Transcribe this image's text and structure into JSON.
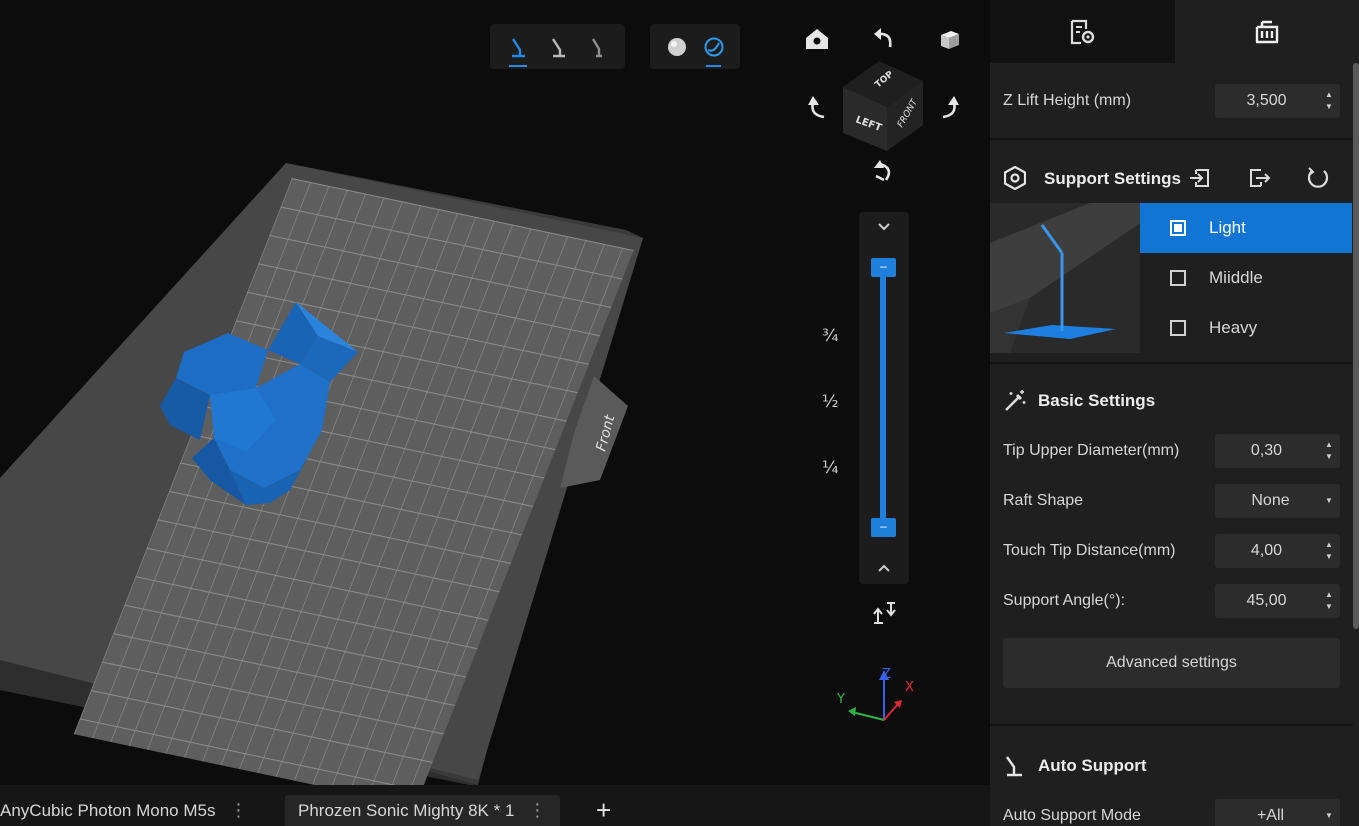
{
  "toolbar": {
    "support_tools": [
      "support-tool-1-icon",
      "support-tool-2-icon",
      "support-tool-3-icon"
    ],
    "view_modes": [
      "solid-view-icon",
      "xray-view-icon"
    ]
  },
  "viewport": {
    "plate_label": "Front",
    "nav_cube": {
      "top": "TOP",
      "front": "FRONT",
      "left": "LEFT"
    },
    "slider_fractions": [
      "¾",
      "½",
      "¼"
    ],
    "axis": {
      "x": "X",
      "y": "Y",
      "z": "Z"
    },
    "colors": {
      "model": "#1e6fc6",
      "accent": "#1f8be8",
      "axis_x": "#e0283a",
      "axis_y": "#2cb44a",
      "axis_z": "#3a62e8"
    }
  },
  "panel": {
    "tabs": [
      "file-settings-icon",
      "support-panel-icon"
    ],
    "z_lift": {
      "label": "Z Lift Height (mm)",
      "value": "3,500"
    },
    "support_settings": {
      "title": "Support Settings",
      "presets": [
        {
          "label": "Light",
          "selected": true
        },
        {
          "label": "Miiddle",
          "selected": false
        },
        {
          "label": "Heavy",
          "selected": false
        }
      ]
    },
    "basic_settings": {
      "title": "Basic Settings",
      "tip_upper_diameter": {
        "label": "Tip Upper Diameter(mm)",
        "value": "0,30"
      },
      "raft_shape": {
        "label": "Raft Shape",
        "value": "None"
      },
      "touch_tip_distance": {
        "label": "Touch Tip Distance(mm)",
        "value": "4,00"
      },
      "support_angle": {
        "label": "Support Angle(°):",
        "value": "45,00"
      },
      "advanced_label": "Advanced settings"
    },
    "auto_support": {
      "title": "Auto Support",
      "mode": {
        "label": "Auto Support Mode",
        "value": "+All"
      }
    }
  },
  "bottom_tabs": [
    {
      "label": "AnyCubic Photon Mono M5s",
      "active": false
    },
    {
      "label": "Phrozen Sonic Mighty 8K * 1",
      "active": true
    }
  ],
  "add_tab_label": "+"
}
